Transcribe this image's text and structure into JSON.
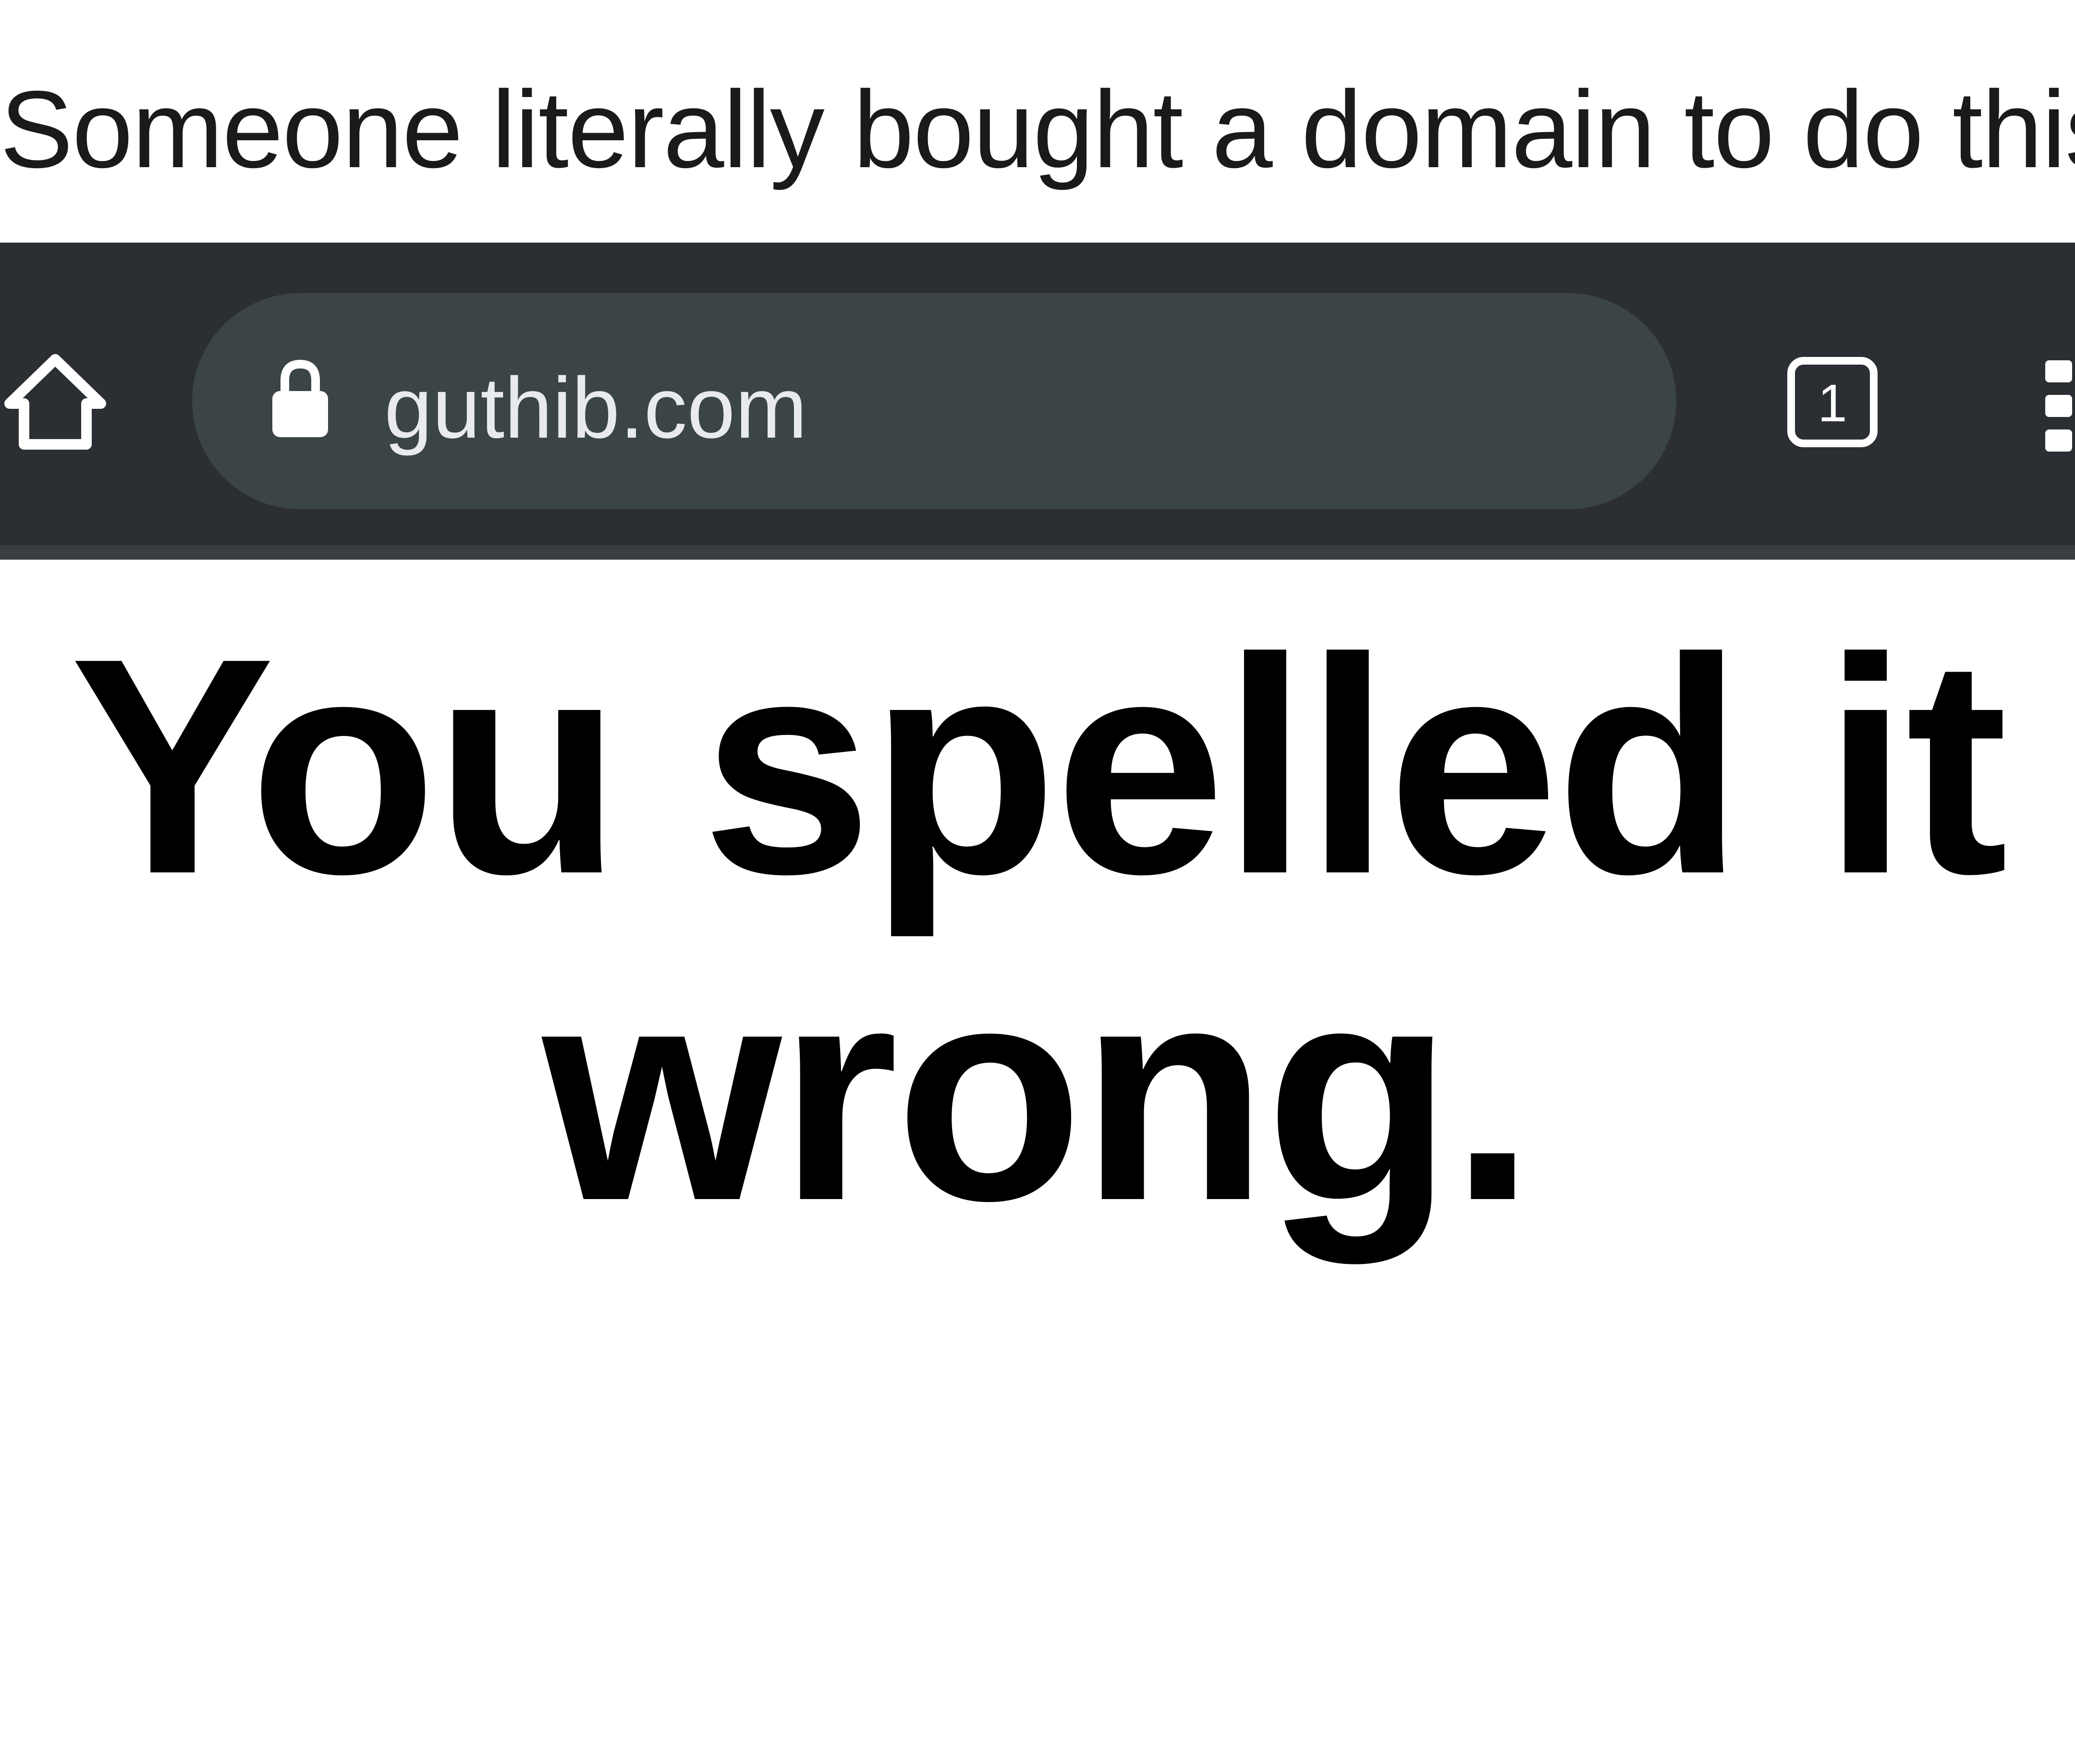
{
  "caption": "Someone literally bought a domain to do this",
  "browser": {
    "url": "guthib.com",
    "tab_count": "1",
    "icons": {
      "home": "home-icon",
      "lock": "lock-icon",
      "tabs": "tab-switcher-icon",
      "menu": "overflow-menu-icon"
    },
    "colors": {
      "toolbar": "#2b2e33",
      "omnibox": "#3b4446",
      "icon": "#ffffff"
    }
  },
  "page": {
    "headline_line1": "You spelled it",
    "headline_line2": "wrong."
  }
}
